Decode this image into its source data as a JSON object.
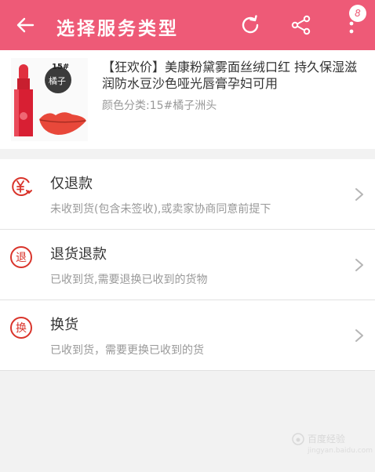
{
  "header": {
    "title": "选择服务类型",
    "badge_count": "8",
    "icons": [
      "back-arrow-icon",
      "refresh-icon",
      "share-icon",
      "more-vertical-icon"
    ]
  },
  "product": {
    "thumb_number": "15#",
    "thumb_text": "橘子",
    "name": "【狂欢价】美康粉黛雾面丝绒口红 持久保湿滋润防水豆沙色哑光唇膏孕妇可用",
    "spec": "颜色分类:15#橘子洲头"
  },
  "options": [
    {
      "title": "仅退款",
      "desc": "未收到货(包含未签收),或卖家协商同意前提下",
      "icon": "refund-yen-icon",
      "icon_text": ""
    },
    {
      "title": "退货退款",
      "desc": "已收到货,需要退换已收到的货物",
      "icon": "return-icon",
      "icon_text": "退"
    },
    {
      "title": "换货",
      "desc": "已收到货，需要更换已收到的货",
      "icon": "exchange-icon",
      "icon_text": "换"
    }
  ],
  "watermark": {
    "text": "百度经验",
    "sub": "jingyan.baidu.com"
  },
  "colors": {
    "brand": "#ee5a77",
    "icon_red": "#d9342b",
    "text": "#333333",
    "subtext": "#999999"
  }
}
